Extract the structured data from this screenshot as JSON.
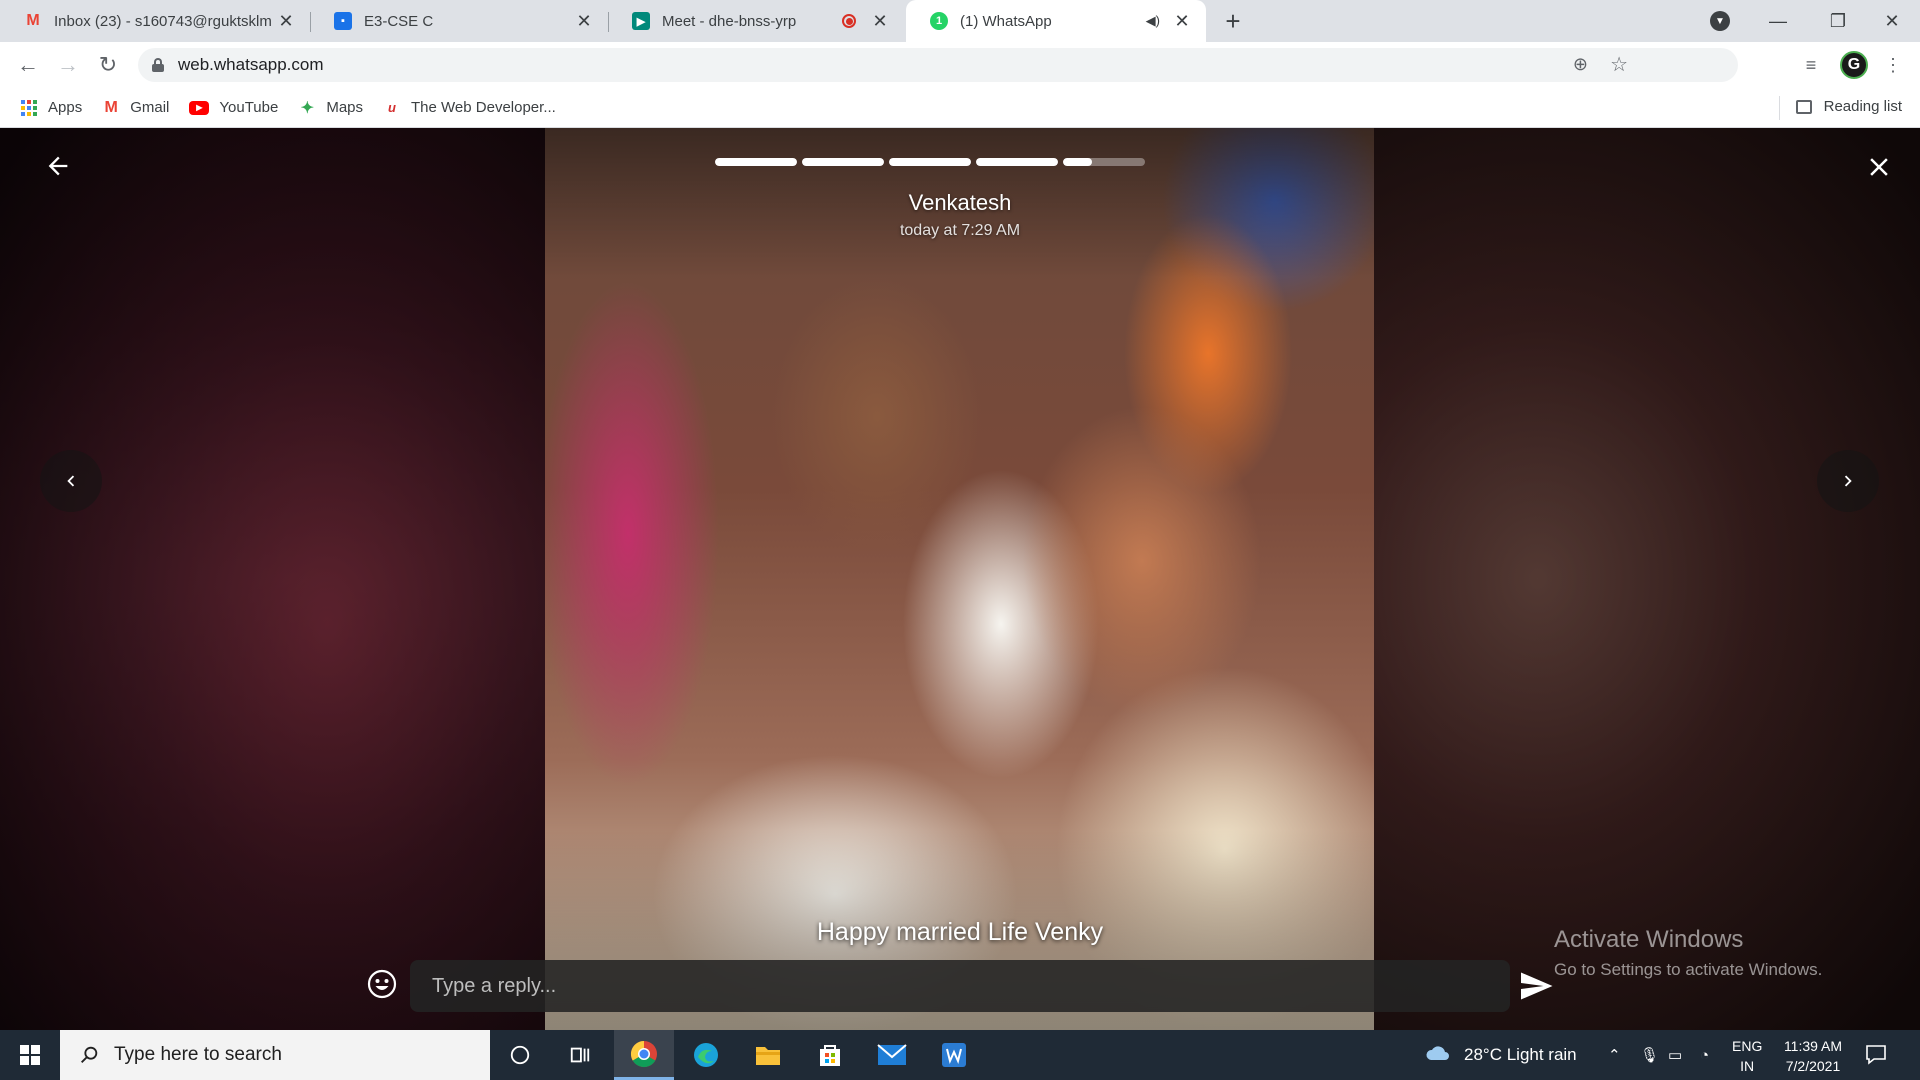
{
  "browser": {
    "tabs": [
      {
        "title": "Inbox (23) - s160743@rguktsklm",
        "favicon": "gmail-icon",
        "color": "#ea4335"
      },
      {
        "title": "E3-CSE C",
        "favicon": "classroom-icon",
        "color": "#1a73e8"
      },
      {
        "title": "Meet - dhe-bnss-yrp",
        "favicon": "meet-icon",
        "color": "#00897b"
      },
      {
        "title": "(1) WhatsApp",
        "favicon": "whatsapp-icon",
        "color": "#25d366"
      }
    ],
    "url": "web.whatsapp.com",
    "bookmarks": [
      "Apps",
      "Gmail",
      "YouTube",
      "Maps",
      "The Web Developer..."
    ],
    "reading_list": "Reading list",
    "profile_letter": "G"
  },
  "status": {
    "poster_name": "Venkatesh",
    "posted_time": "today at 7:29 AM",
    "caption": "Happy married Life Venky",
    "reply_placeholder": "Type a reply...",
    "progress_segments": [
      1,
      1,
      1,
      1,
      0.35
    ],
    "accent": "#ffffff"
  },
  "watermark": {
    "title": "Activate Windows",
    "subtitle": "Go to Settings to activate Windows."
  },
  "taskbar": {
    "search_placeholder": "Type here to search",
    "weather": "28°C  Light rain",
    "lang_line1": "ENG",
    "lang_line2": "IN",
    "time": "11:39 AM",
    "date": "7/2/2021"
  }
}
